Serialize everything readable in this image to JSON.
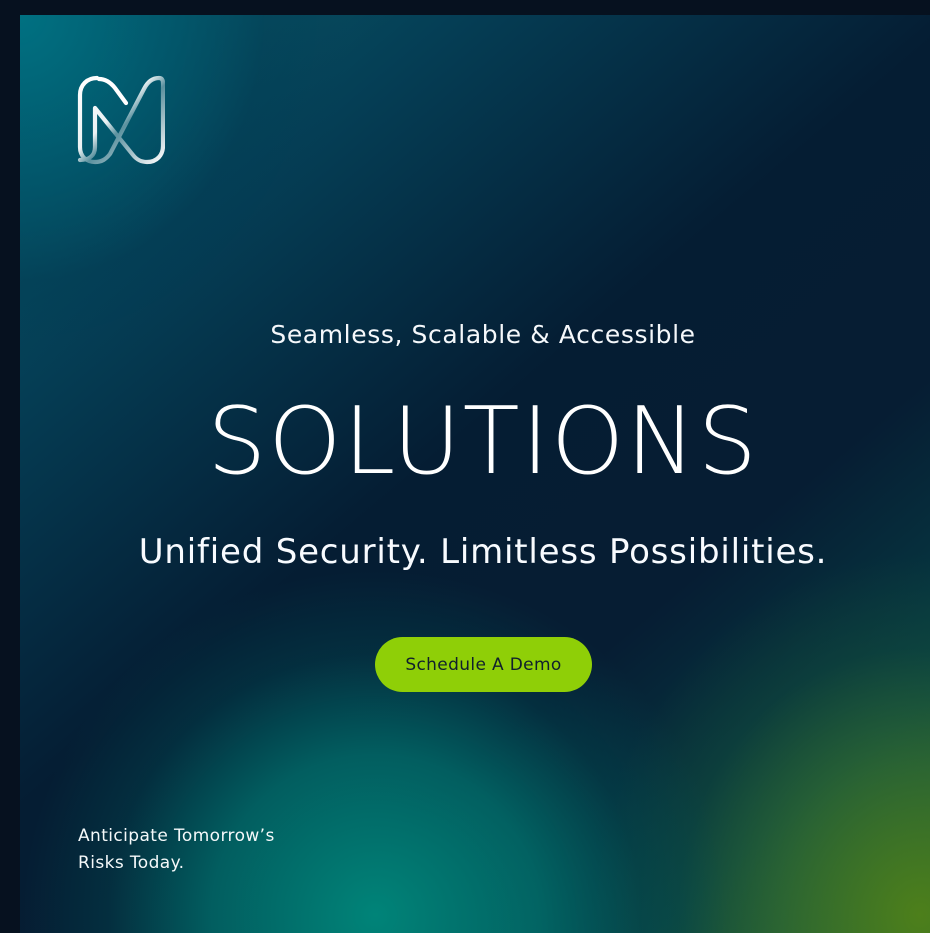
{
  "hero": {
    "tagline": "Seamless, Scalable & Accessible",
    "headline": "SOLUTIONS",
    "subheadline": "Unified Security. Limitless Possibilities.",
    "cta_label": "Schedule A Demo",
    "footer_lines": [
      "Anticipate Tomorrow’s",
      "Risks Today."
    ]
  },
  "logo": {
    "icon": "brand-logo-icon"
  },
  "colors": {
    "background": "#06111f",
    "cta": "#8fcf07",
    "text": "#ffffff",
    "teal": "#00897c",
    "green": "#4e801a"
  }
}
